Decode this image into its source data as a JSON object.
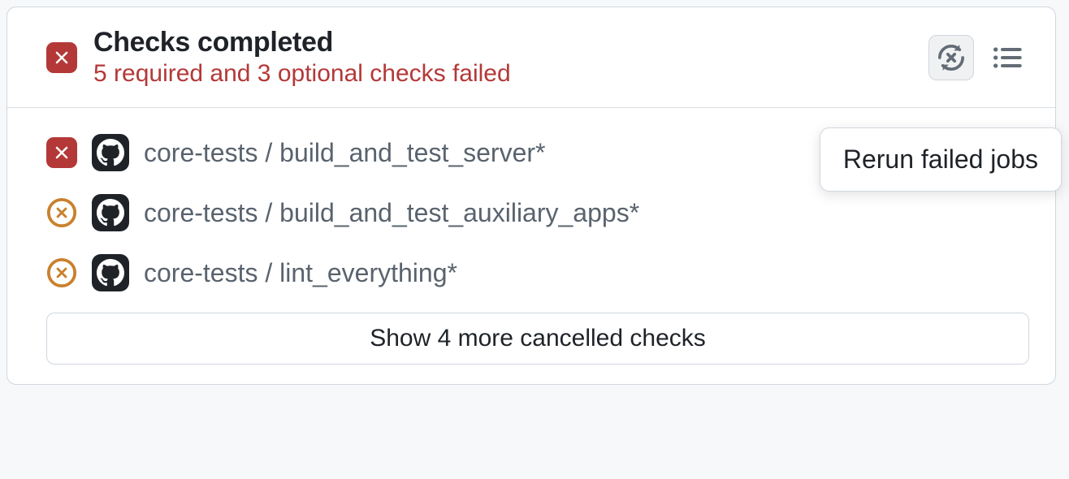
{
  "header": {
    "title": "Checks completed",
    "subtitle": "5 required and 3 optional checks failed"
  },
  "tooltip": {
    "rerun": "Rerun failed jobs"
  },
  "checks": [
    {
      "status": "failed",
      "name": "core-tests / build_and_test_server*"
    },
    {
      "status": "cancelled",
      "name": "core-tests / build_and_test_auxiliary_apps*"
    },
    {
      "status": "cancelled",
      "name": "core-tests / lint_everything*"
    }
  ],
  "showMore": {
    "label": "Show 4 more cancelled checks"
  }
}
